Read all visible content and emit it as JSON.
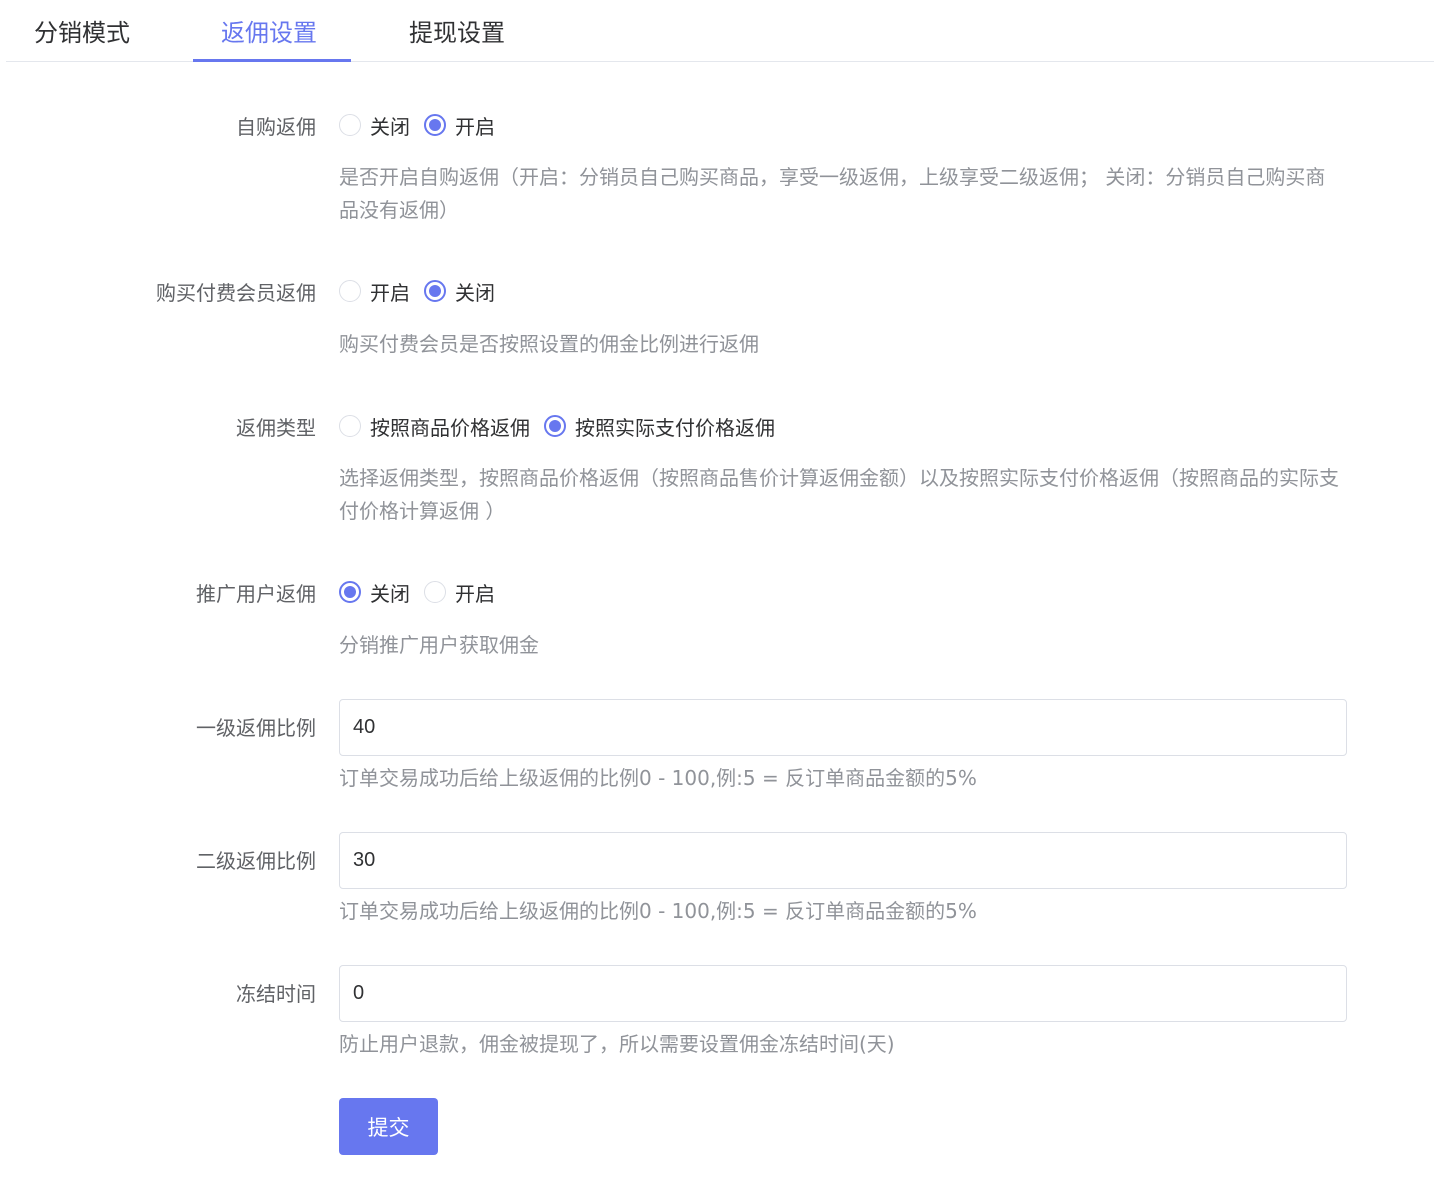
{
  "tabs": [
    {
      "label": "分销模式",
      "active": false
    },
    {
      "label": "返佣设置",
      "active": true
    },
    {
      "label": "提现设置",
      "active": false
    }
  ],
  "accent_color": "#6777ef",
  "form": {
    "self_purchase": {
      "label": "自购返佣",
      "options": [
        {
          "label": "关闭",
          "checked": false
        },
        {
          "label": "开启",
          "checked": true
        }
      ],
      "help": "是否开启自购返佣（开启：分销员自己购买商品，享受一级返佣，上级享受二级返佣； 关闭：分销员自己购买商品没有返佣）"
    },
    "paid_member": {
      "label": "购买付费会员返佣",
      "options": [
        {
          "label": "开启",
          "checked": false
        },
        {
          "label": "关闭",
          "checked": true
        }
      ],
      "help": "购买付费会员是否按照设置的佣金比例进行返佣"
    },
    "commission_type": {
      "label": "返佣类型",
      "options": [
        {
          "label": "按照商品价格返佣",
          "checked": false
        },
        {
          "label": "按照实际支付价格返佣",
          "checked": true
        }
      ],
      "help": "选择返佣类型，按照商品价格返佣（按照商品售价计算返佣金额）以及按照实际支付价格返佣（按照商品的实际支付价格计算返佣 ）"
    },
    "promote_user": {
      "label": "推广用户返佣",
      "options": [
        {
          "label": "关闭",
          "checked": true
        },
        {
          "label": "开启",
          "checked": false
        }
      ],
      "help": "分销推广用户获取佣金"
    },
    "level1": {
      "label": "一级返佣比例",
      "value": "40",
      "help": "订单交易成功后给上级返佣的比例0 - 100,例:5 = 反订单商品金额的5%"
    },
    "level2": {
      "label": "二级返佣比例",
      "value": "30",
      "help": "订单交易成功后给上级返佣的比例0 - 100,例:5 = 反订单商品金额的5%"
    },
    "freeze": {
      "label": "冻结时间",
      "value": "0",
      "help": "防止用户退款，佣金被提现了，所以需要设置佣金冻结时间(天)"
    },
    "submit_label": "提交"
  }
}
